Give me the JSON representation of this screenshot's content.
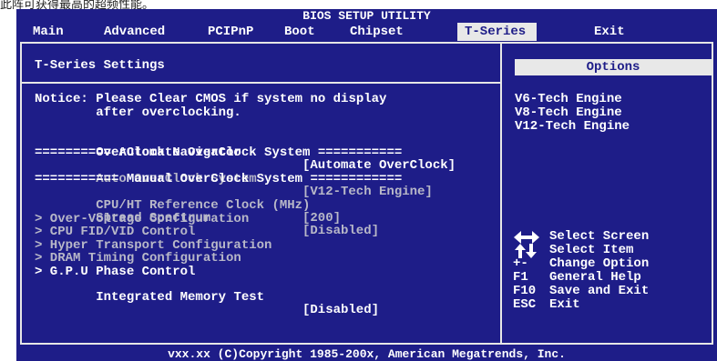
{
  "caption_strip": "此阵可获得最高的超频性能。",
  "bios": {
    "utility_title": "BIOS SETUP UTILITY",
    "menu": [
      "Main",
      "Advanced",
      "PCIPnP",
      "Boot",
      "Chipset",
      "T-Series",
      "Exit"
    ],
    "active_menu": "T-Series",
    "footer": "vxx.xx (C)Copyright 1985-200x, American Megatrends, Inc."
  },
  "settings": {
    "title": "T-Series Settings",
    "notice_line1": "Notice: Please Clear CMOS if system no display",
    "notice_line2": "        after overclocking.",
    "overclock_navigator": {
      "label": "OverClock Navigator",
      "value": "[Automate OverClock]"
    },
    "automate_header": "========== Automate OverClock System ===========",
    "auto_overclock": {
      "label": "Auto OverClock System",
      "value": "[V12-Tech Engine]"
    },
    "manual_header": "=========== Manual OverClock System ============",
    "cpu_ht_ref": {
      "label": "CPU/HT Reference Clock (MHz)",
      "value": "[200]"
    },
    "spread_spectrum": {
      "label": "Spread Spectrum",
      "value": "[Disabled]"
    },
    "submenus": [
      "> Over-Voltage Configuration",
      "> CPU FID/VID Control",
      "> Hyper Transport Configuration",
      "> DRAM Timing Configuration"
    ],
    "gpu_phase": "> G.P.U Phase Control",
    "integrated_memory_test": {
      "label": "Integrated Memory Test",
      "value": "[Disabled]"
    }
  },
  "options": {
    "header": "Options",
    "items": [
      "V6-Tech Engine",
      "V8-Tech Engine",
      "V12-Tech Engine"
    ]
  },
  "help": {
    "select_screen": "Select Screen",
    "select_item": "Select Item",
    "rows": [
      {
        "key": "+-",
        "text": "Change Option"
      },
      {
        "key": "F1",
        "text": "General Help"
      },
      {
        "key": "F10",
        "text": "Save and Exit"
      },
      {
        "key": "ESC",
        "text": "Exit"
      }
    ]
  },
  "colors": {
    "background": "#1e1d88",
    "highlight": "#e8e8e8",
    "text": "#ffffff",
    "disabled_text": "#b8b8c8"
  }
}
